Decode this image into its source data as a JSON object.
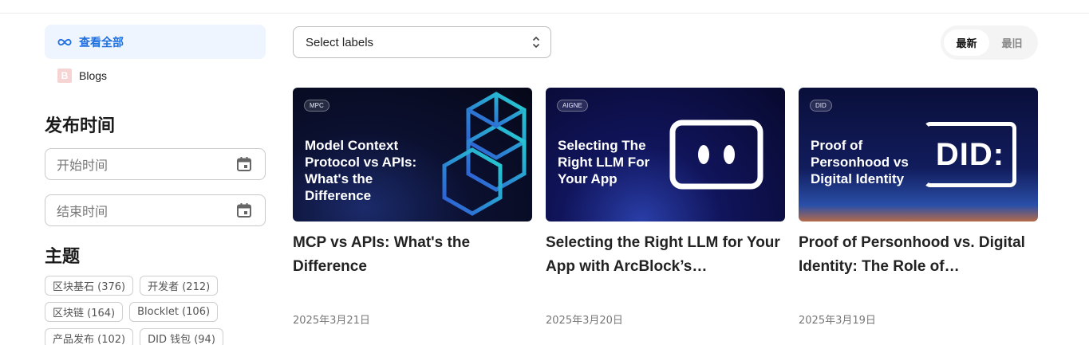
{
  "sidebar": {
    "view_all": "查看全部",
    "blogs": "Blogs",
    "blogs_icon_letter": "B",
    "publish_time_title": "发布时间",
    "start_placeholder": "开始时间",
    "end_placeholder": "结束时间",
    "topics_title": "主题",
    "topics": [
      {
        "label": "区块基石 (376)"
      },
      {
        "label": "开发者 (212)"
      },
      {
        "label": "区块链 (164)"
      },
      {
        "label": "Blocklet (106)"
      },
      {
        "label": "产品发布 (102)"
      },
      {
        "label": "DID 钱包 (94)"
      }
    ]
  },
  "toolbar": {
    "select_placeholder": "Select labels",
    "sort_latest": "最新",
    "sort_oldest": "最旧"
  },
  "cards": [
    {
      "tag": "MPC",
      "image_title": "Model Context Protocol vs APIs: What's the Difference",
      "title": "MCP vs APIs: What's the Difference",
      "date": "2025年3月21日"
    },
    {
      "tag": "AIGNE",
      "image_title": "Selecting The Right LLM For Your App",
      "title": "Selecting the Right LLM for Your App with ArcBlock’s…",
      "date": "2025年3月20日"
    },
    {
      "tag": "DID",
      "image_title": "Proof of Personhood vs Digital Identity",
      "image_logo": "DID:",
      "title": "Proof of Personhood vs. Digital Identity: The Role of…",
      "date": "2025年3月19日"
    }
  ],
  "colors": {
    "accent": "#1f6fe0",
    "active_nav_bg": "#eef5ff"
  }
}
